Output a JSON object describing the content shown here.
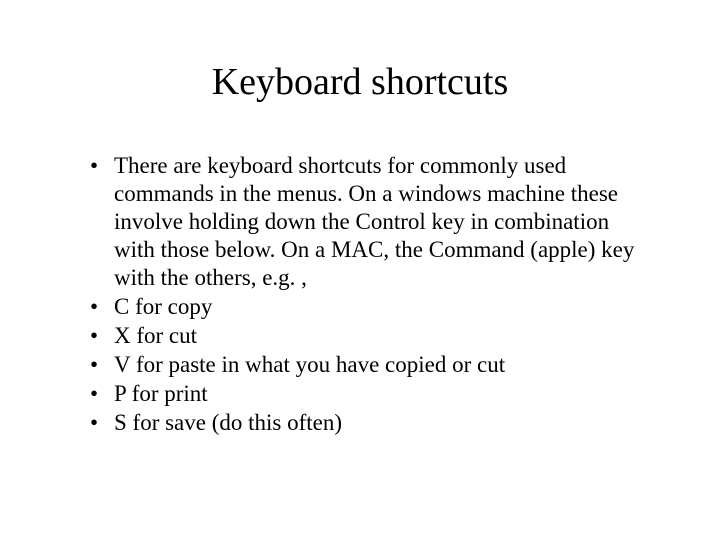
{
  "title": "Keyboard shortcuts",
  "bullets": [
    "There are keyboard shortcuts for commonly used commands in the menus.  On a windows machine these involve holding down the Control key in combination with those below.  On a MAC, the Command (apple) key with the others, e.g. ,",
    "C for copy",
    "X for cut",
    "V for paste in what you have copied or cut",
    "P for print",
    "S for save (do this often)"
  ]
}
